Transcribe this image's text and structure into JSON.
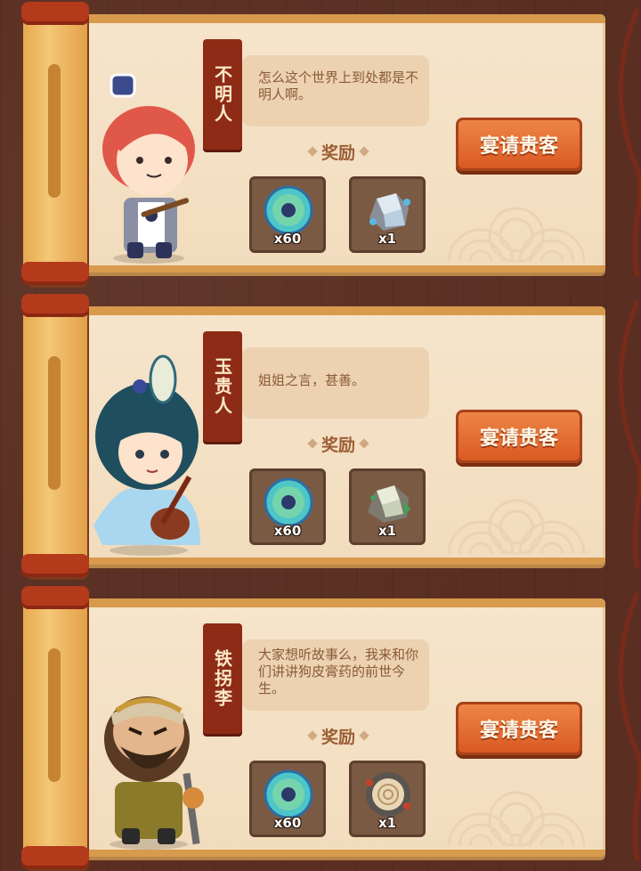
{
  "guests": [
    {
      "name": "不明人",
      "quote": "怎么这个世界上到处都是不明人啊。",
      "reward_label": "奖励",
      "button_label": "宴请贵客",
      "rewards": [
        {
          "icon": "jade-coin-icon",
          "count": "x60"
        },
        {
          "icon": "ice-ore-icon",
          "count": "x1"
        }
      ]
    },
    {
      "name": "玉贵人",
      "quote": "姐姐之言，甚善。",
      "reward_label": "奖励",
      "button_label": "宴请贵客",
      "rewards": [
        {
          "icon": "jade-coin-icon",
          "count": "x60"
        },
        {
          "icon": "jade-ore-icon",
          "count": "x1"
        }
      ]
    },
    {
      "name": "铁拐李",
      "quote": "大家想听故事么，我来和你们讲讲狗皮膏药的前世今生。",
      "reward_label": "奖励",
      "button_label": "宴请贵客",
      "rewards": [
        {
          "icon": "jade-coin-icon",
          "count": "x60"
        },
        {
          "icon": "wood-log-icon",
          "count": "x1"
        }
      ]
    }
  ],
  "colors": {
    "background": "#5a2f22",
    "paper": "#f6e5cc",
    "button": "#e36a2c",
    "name_tag": "#8e2b16"
  }
}
